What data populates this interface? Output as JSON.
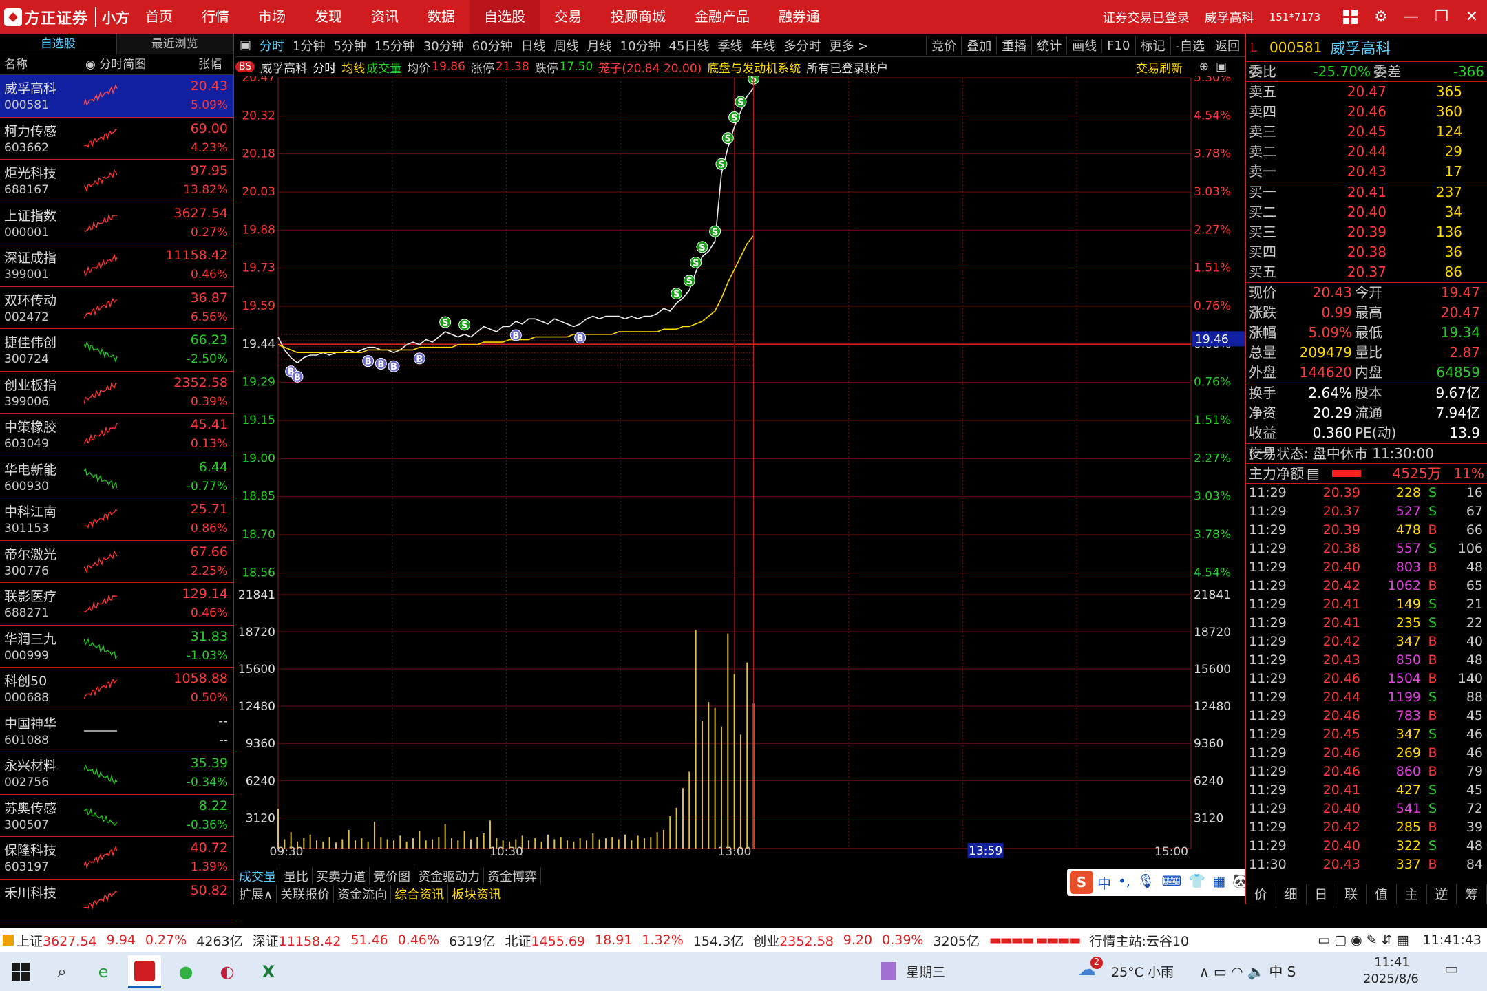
{
  "topbar": {
    "brand": "方正证券",
    "product": "小方",
    "nav": [
      "首页",
      "行情",
      "市场",
      "发现",
      "资讯",
      "数据",
      "自选股",
      "交易",
      "投顾商城",
      "金融产品",
      "融券通"
    ],
    "active_nav": 6,
    "status": "证券交易已登录",
    "stock": "威孚高科",
    "account": "151*7173"
  },
  "left": {
    "tabs": [
      "自选股",
      "最近浏览"
    ],
    "headers": [
      "名称",
      "分时简图",
      "张幅"
    ],
    "rows": [
      {
        "name": "威孚高科",
        "code": "000581",
        "price": "20.43",
        "pct": "5.09%",
        "dir": "up",
        "selected": true
      },
      {
        "name": "柯力传感",
        "code": "603662",
        "price": "69.00",
        "pct": "4.23%",
        "dir": "up"
      },
      {
        "name": "炬光科技",
        "code": "688167",
        "price": "97.95",
        "pct": "13.82%",
        "dir": "up"
      },
      {
        "name": "上证指数",
        "code": "000001",
        "price": "3627.54",
        "pct": "0.27%",
        "dir": "up"
      },
      {
        "name": "深证成指",
        "code": "399001",
        "price": "11158.42",
        "pct": "0.46%",
        "dir": "up"
      },
      {
        "name": "双环传动",
        "code": "002472",
        "price": "36.87",
        "pct": "6.56%",
        "dir": "up"
      },
      {
        "name": "捷佳伟创",
        "code": "300724",
        "price": "66.23",
        "pct": "-2.50%",
        "dir": "dn"
      },
      {
        "name": "创业板指",
        "code": "399006",
        "price": "2352.58",
        "pct": "0.39%",
        "dir": "up"
      },
      {
        "name": "中策橡胶",
        "code": "603049",
        "price": "45.41",
        "pct": "0.13%",
        "dir": "up"
      },
      {
        "name": "华电新能",
        "code": "600930",
        "price": "6.44",
        "pct": "-0.77%",
        "dir": "dn"
      },
      {
        "name": "中科江南",
        "code": "301153",
        "price": "25.71",
        "pct": "0.86%",
        "dir": "up"
      },
      {
        "name": "帝尔激光",
        "code": "300776",
        "price": "67.66",
        "pct": "2.25%",
        "dir": "up"
      },
      {
        "name": "联影医疗",
        "code": "688271",
        "price": "129.14",
        "pct": "0.46%",
        "dir": "up"
      },
      {
        "name": "华润三九",
        "code": "000999",
        "price": "31.83",
        "pct": "-1.03%",
        "dir": "dn"
      },
      {
        "name": "科创50",
        "code": "000688",
        "price": "1058.88",
        "pct": "0.50%",
        "dir": "up"
      },
      {
        "name": "中国神华",
        "code": "601088",
        "price": "--",
        "pct": "--",
        "dir": "flat"
      },
      {
        "name": "永兴材料",
        "code": "002756",
        "price": "35.39",
        "pct": "-0.34%",
        "dir": "dn"
      },
      {
        "name": "苏奥传感",
        "code": "300507",
        "price": "8.22",
        "pct": "-0.36%",
        "dir": "dn"
      },
      {
        "name": "保隆科技",
        "code": "603197",
        "price": "40.72",
        "pct": "1.39%",
        "dir": "up"
      },
      {
        "name": "禾川科技",
        "code": "",
        "price": "50.82",
        "pct": "",
        "dir": "up"
      }
    ]
  },
  "chartbar": {
    "periods": [
      "分时",
      "1分钟",
      "5分钟",
      "15分钟",
      "30分钟",
      "60分钟",
      "日线",
      "周线",
      "月线",
      "10分钟",
      "45日线",
      "季线",
      "年线",
      "多分时",
      "更多 >"
    ],
    "tools": [
      "竞价",
      "叠加",
      "重播",
      "统计",
      "画线",
      "F10",
      "标记",
      "-自选",
      "返回"
    ]
  },
  "info": {
    "tag": "BS",
    "name": "威孚高科",
    "mode": "分时",
    "avgline": "均线",
    "vol": "成交量",
    "avg_lbl": "均价",
    "avg": "19.86",
    "limit_up_lbl": "涨停",
    "limit_up": "21.38",
    "limit_dn_lbl": "跌停",
    "limit_dn": "17.50",
    "cage": "笼子(20.84  20.00)",
    "system": "底盘与发动机系统",
    "acct": "所有已登录账户",
    "trade_refresh": "交易刷新"
  },
  "chart_data": {
    "type": "line",
    "prev_close": 19.44,
    "price_ticks": [
      "20.47",
      "20.32",
      "20.18",
      "20.03",
      "19.88",
      "19.73",
      "19.59",
      "19.44",
      "19.29",
      "19.15",
      "19.00",
      "18.85",
      "18.70",
      "18.56"
    ],
    "pct_ticks": [
      "5.30%",
      "4.54%",
      "3.78%",
      "3.03%",
      "2.27%",
      "1.51%",
      "0.76%",
      "0.00%",
      "0.76%",
      "1.51%",
      "2.27%",
      "3.03%",
      "3.78%",
      "4.54%"
    ],
    "vol_ticks": [
      "21841",
      "18720",
      "15600",
      "12480",
      "9360",
      "6240",
      "3120"
    ],
    "time_ticks": [
      "09:30",
      "10:30",
      "13:00",
      "15:00"
    ],
    "cursor_time": "13:59",
    "cursor_price": "19.46",
    "price": [
      19.47,
      19.42,
      19.39,
      19.37,
      19.39,
      19.4,
      19.4,
      19.41,
      19.4,
      19.41,
      19.41,
      19.42,
      19.41,
      19.42,
      19.43,
      19.43,
      19.42,
      19.42,
      19.41,
      19.42,
      19.44,
      19.45,
      19.44,
      19.46,
      19.45,
      19.47,
      19.49,
      19.48,
      19.47,
      19.48,
      19.47,
      19.49,
      19.51,
      19.5,
      19.49,
      19.51,
      19.51,
      19.53,
      19.52,
      19.54,
      19.54,
      19.53,
      19.52,
      19.54,
      19.53,
      19.52,
      19.51,
      19.52,
      19.54,
      19.55,
      19.54,
      19.55,
      19.55,
      19.55,
      19.54,
      19.55,
      19.54,
      19.55,
      19.55,
      19.56,
      19.58,
      19.57,
      19.6,
      19.62,
      19.65,
      19.72,
      19.78,
      19.8,
      19.84,
      20.1,
      20.2,
      20.28,
      20.34,
      20.4,
      20.43
    ],
    "avg": [
      19.44,
      19.43,
      19.42,
      19.41,
      19.41,
      19.41,
      19.41,
      19.41,
      19.41,
      19.41,
      19.41,
      19.41,
      19.41,
      19.41,
      19.42,
      19.42,
      19.42,
      19.42,
      19.42,
      19.42,
      19.42,
      19.42,
      19.43,
      19.43,
      19.43,
      19.43,
      19.43,
      19.43,
      19.44,
      19.44,
      19.44,
      19.44,
      19.45,
      19.45,
      19.45,
      19.45,
      19.46,
      19.46,
      19.46,
      19.46,
      19.47,
      19.47,
      19.47,
      19.47,
      19.47,
      19.47,
      19.48,
      19.48,
      19.48,
      19.48,
      19.48,
      19.48,
      19.48,
      19.49,
      19.49,
      19.49,
      19.49,
      19.49,
      19.49,
      19.49,
      19.5,
      19.5,
      19.5,
      19.51,
      19.51,
      19.52,
      19.53,
      19.55,
      19.57,
      19.62,
      19.68,
      19.73,
      19.78,
      19.83,
      19.86
    ],
    "volume": [
      3400,
      800,
      1400,
      600,
      900,
      1200,
      700,
      600,
      1000,
      500,
      800,
      1600,
      700,
      900,
      600,
      2300,
      1000,
      800,
      700,
      1100,
      600,
      900,
      1500,
      700,
      800,
      1000,
      2100,
      900,
      700,
      1500,
      800,
      1000,
      1300,
      2400,
      900,
      700,
      600,
      800,
      1100,
      700,
      900,
      600,
      1200,
      800,
      1000,
      700,
      600,
      900,
      700,
      1300,
      800,
      900,
      1000,
      800,
      1200,
      700,
      1100,
      900,
      1000,
      1400,
      1600,
      2800,
      3500,
      5200,
      6600,
      18800,
      11000,
      12600,
      12100,
      10500,
      18500,
      15000,
      9800,
      16000,
      12500
    ],
    "signals": [
      {
        "i": 2,
        "t": "B"
      },
      {
        "i": 3,
        "t": "B"
      },
      {
        "i": 14,
        "t": "B"
      },
      {
        "i": 16,
        "t": "B"
      },
      {
        "i": 18,
        "t": "B"
      },
      {
        "i": 22,
        "t": "B"
      },
      {
        "i": 26,
        "t": "S"
      },
      {
        "i": 29,
        "t": "S"
      },
      {
        "i": 37,
        "t": "B"
      },
      {
        "i": 47,
        "t": "B"
      },
      {
        "i": 62,
        "t": "S"
      },
      {
        "i": 64,
        "t": "S"
      },
      {
        "i": 65,
        "t": "S"
      },
      {
        "i": 66,
        "t": "S"
      },
      {
        "i": 68,
        "t": "S"
      },
      {
        "i": 69,
        "t": "S"
      },
      {
        "i": 70,
        "t": "S"
      },
      {
        "i": 71,
        "t": "S"
      },
      {
        "i": 72,
        "t": "S"
      },
      {
        "i": 74,
        "t": "S"
      }
    ]
  },
  "bottom": {
    "tabs1": [
      "成交量",
      "量比",
      "买卖力道",
      "竞价图",
      "资金驱动力",
      "资金博弈"
    ],
    "tabs2": [
      "扩展∧",
      "关联报价",
      "资金流向",
      "综合资讯",
      "板块资讯"
    ]
  },
  "right": {
    "code": "000581",
    "name": "威孚高科",
    "webi_lbl": "委比",
    "webi": "-25.70%",
    "wecha_lbl": "委差",
    "wecha": "-366",
    "asks": [
      {
        "lbl": "卖五",
        "p": "20.47",
        "v": "365"
      },
      {
        "lbl": "卖四",
        "p": "20.46",
        "v": "360"
      },
      {
        "lbl": "卖三",
        "p": "20.45",
        "v": "124"
      },
      {
        "lbl": "卖二",
        "p": "20.44",
        "v": "29"
      },
      {
        "lbl": "卖一",
        "p": "20.43",
        "v": "17"
      }
    ],
    "bids": [
      {
        "lbl": "买一",
        "p": "20.41",
        "v": "237"
      },
      {
        "lbl": "买二",
        "p": "20.40",
        "v": "34"
      },
      {
        "lbl": "买三",
        "p": "20.39",
        "v": "136"
      },
      {
        "lbl": "买四",
        "p": "20.38",
        "v": "36"
      },
      {
        "lbl": "买五",
        "p": "20.37",
        "v": "86"
      }
    ],
    "quote1": [
      {
        "k": "现价",
        "a": "20.43",
        "ac": "up",
        "k2": "今开",
        "b": "19.47",
        "bc": "up"
      },
      {
        "k": "涨跌",
        "a": "0.99",
        "ac": "up",
        "k2": "最高",
        "b": "20.47",
        "bc": "up"
      },
      {
        "k": "涨幅",
        "a": "5.09%",
        "ac": "up",
        "k2": "最低",
        "b": "19.34",
        "bc": "dn"
      },
      {
        "k": "总量",
        "a": "209479",
        "ac": "yl",
        "k2": "量比",
        "b": "2.87",
        "bc": "up"
      },
      {
        "k": "外盘",
        "a": "144620",
        "ac": "up",
        "k2": "内盘",
        "b": "64859",
        "bc": "dn"
      }
    ],
    "quote2": [
      {
        "k": "换手",
        "a": "2.64%",
        "k2": "股本",
        "b": "9.67亿"
      },
      {
        "k": "净资",
        "a": "20.29",
        "k2": "流通",
        "b": "7.94亿"
      },
      {
        "k": "收益(一)",
        "a": "0.360",
        "k2": "PE(动)",
        "b": "13.9"
      }
    ],
    "state_lbl": "交易状态:",
    "state": "盘中休市 11:30:00",
    "mainflow_lbl": "主力净额",
    "mainflow": "4525万",
    "mainflow_pct": "11%",
    "ticks": [
      [
        "11:29",
        "20.39",
        "228",
        "S",
        "16"
      ],
      [
        "11:29",
        "20.37",
        "527",
        "S",
        "67"
      ],
      [
        "11:29",
        "20.39",
        "478",
        "B",
        "66"
      ],
      [
        "11:29",
        "20.38",
        "557",
        "S",
        "106"
      ],
      [
        "11:29",
        "20.40",
        "803",
        "B",
        "48"
      ],
      [
        "11:29",
        "20.42",
        "1062",
        "B",
        "65"
      ],
      [
        "11:29",
        "20.41",
        "149",
        "S",
        "21"
      ],
      [
        "11:29",
        "20.41",
        "235",
        "S",
        "22"
      ],
      [
        "11:29",
        "20.42",
        "347",
        "B",
        "40"
      ],
      [
        "11:29",
        "20.43",
        "850",
        "B",
        "48"
      ],
      [
        "11:29",
        "20.46",
        "1504",
        "B",
        "140"
      ],
      [
        "11:29",
        "20.44",
        "1199",
        "S",
        "88"
      ],
      [
        "11:29",
        "20.46",
        "783",
        "B",
        "45"
      ],
      [
        "11:29",
        "20.45",
        "347",
        "S",
        "46"
      ],
      [
        "11:29",
        "20.46",
        "269",
        "B",
        "46"
      ],
      [
        "11:29",
        "20.46",
        "860",
        "B",
        "79"
      ],
      [
        "11:29",
        "20.41",
        "427",
        "S",
        "45"
      ],
      [
        "11:29",
        "20.40",
        "541",
        "S",
        "72"
      ],
      [
        "11:29",
        "20.42",
        "285",
        "B",
        "39"
      ],
      [
        "11:29",
        "20.40",
        "322",
        "S",
        "48"
      ],
      [
        "11:30",
        "20.43",
        "337",
        "B",
        "84"
      ]
    ],
    "foot": [
      "价",
      "细",
      "日",
      "联",
      "值",
      "主",
      "逆",
      "筹"
    ]
  },
  "statusbar": {
    "sh_lbl": "上证",
    "sh": "3627.54",
    "sh_chg": "9.94",
    "sh_pct": "0.27%",
    "sh_amt": "4263亿",
    "sz_lbl": "深证",
    "sz": "11158.42",
    "sz_chg": "51.46",
    "sz_pct": "0.46%",
    "sz_amt": "6319亿",
    "bj_lbl": "北证",
    "bj": "1455.69",
    "bj_chg": "18.91",
    "bj_pct": "1.32%",
    "bj_amt": "154.3亿",
    "cy_lbl": "创业",
    "cy": "2352.58",
    "cy_chg": "9.20",
    "cy_pct": "0.39%",
    "cy_amt": "3205亿",
    "host": "行情主站:云谷10",
    "time": "11:41:43"
  },
  "taskbar": {
    "weekday": "星期三",
    "weather_badge": "2",
    "weather": "25°C  小雨",
    "clock": "11:41",
    "date": "2025/8/6"
  },
  "ime": {
    "items": [
      "中",
      "•,",
      "🎙",
      "⌨",
      "👕",
      "▦",
      "🐼"
    ]
  }
}
